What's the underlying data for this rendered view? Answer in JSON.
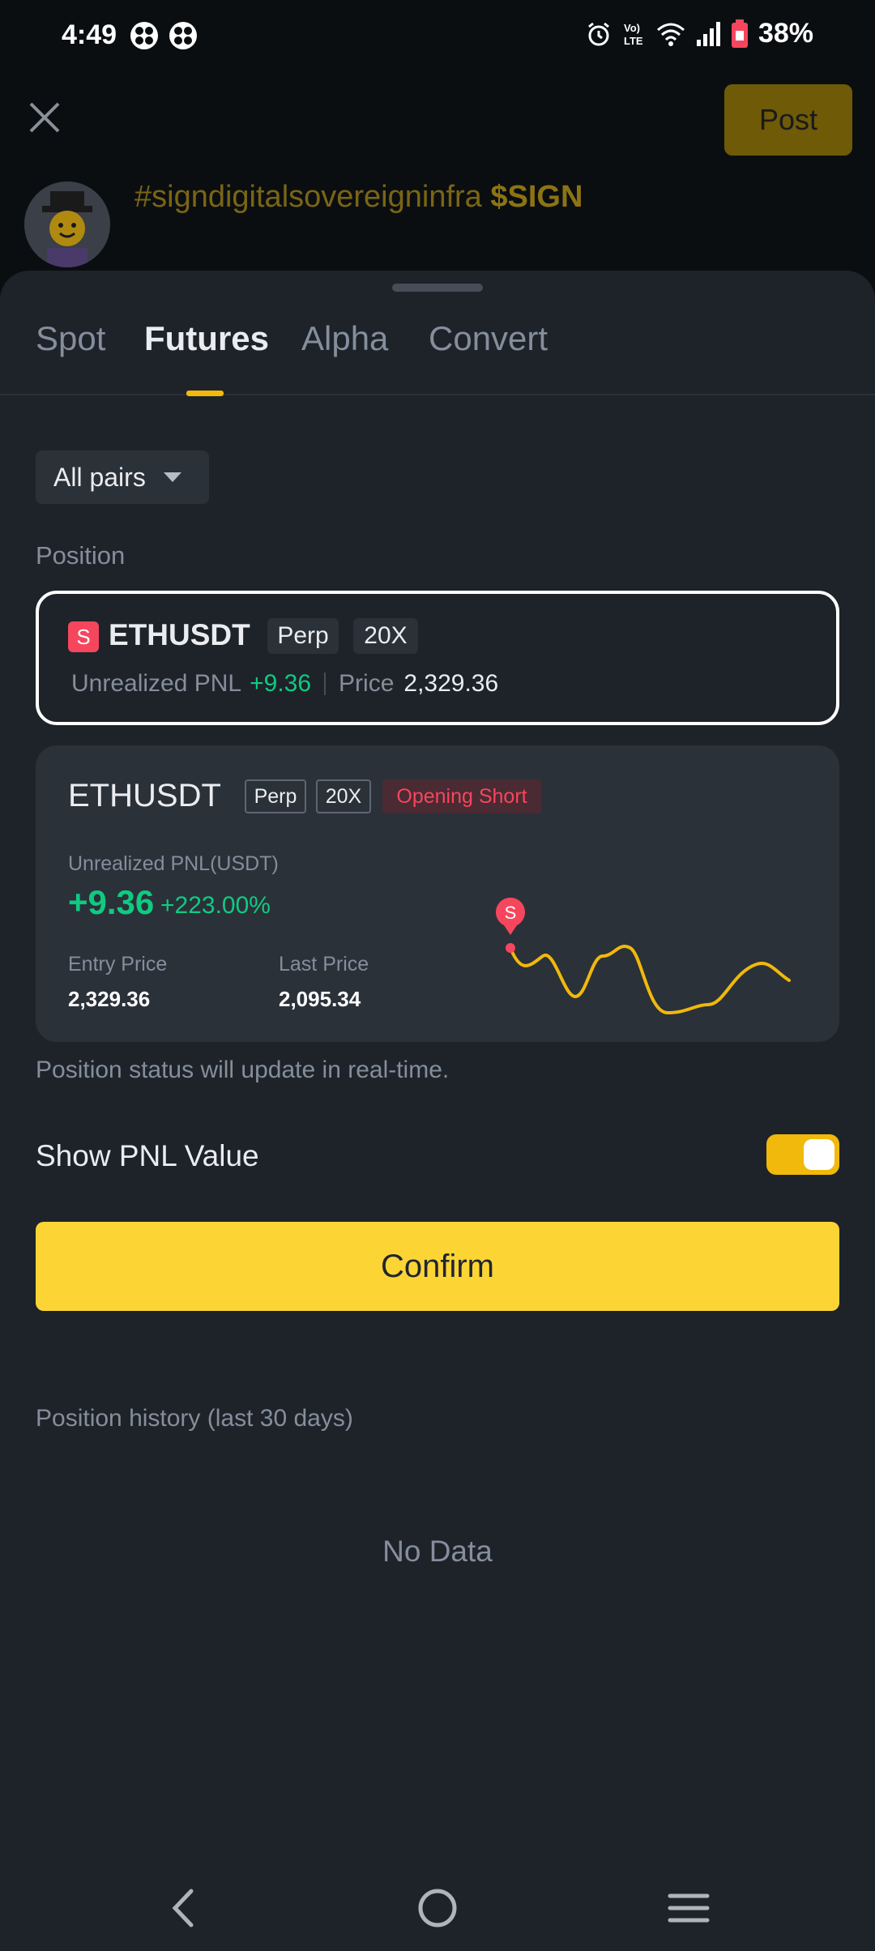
{
  "status_bar": {
    "time": "4:49",
    "battery_pct": "38%",
    "icons": [
      "app-icon",
      "app-icon",
      "alarm-icon",
      "volte-icon",
      "wifi-icon",
      "signal-icon",
      "battery-icon"
    ]
  },
  "compose": {
    "post_label": "Post",
    "text_hashtag": "#signdigitalsovereigninfra",
    "text_ticker": "$SIGN"
  },
  "tabs": [
    {
      "label": "Spot",
      "active": false
    },
    {
      "label": "Futures",
      "active": true
    },
    {
      "label": "Alpha",
      "active": false
    },
    {
      "label": "Convert",
      "active": false
    }
  ],
  "filter": {
    "label": "All pairs"
  },
  "position_section": {
    "label": "Position"
  },
  "position_card": {
    "badge": "S",
    "symbol": "ETHUSDT",
    "tag_type": "Perp",
    "tag_leverage": "20X",
    "pnl_label": "Unrealized PNL",
    "pnl_value": "+9.36",
    "price_label": "Price",
    "price_value": "2,329.36"
  },
  "share_card": {
    "symbol": "ETHUSDT",
    "tag_type": "Perp",
    "tag_leverage": "20X",
    "tag_side": "Opening Short",
    "pnl_label": "Unrealized PNL(USDT)",
    "pnl_value": "+9.36",
    "pnl_pct": "+223.00%",
    "entry_label": "Entry Price",
    "entry_value": "2,329.36",
    "last_label": "Last Price",
    "last_value": "2,095.34",
    "marker": "S"
  },
  "note": "Position status will update in real-time.",
  "show_pnl": {
    "label": "Show PNL Value",
    "enabled": true
  },
  "confirm_label": "Confirm",
  "history": {
    "label": "Position history (last 30 days)",
    "empty_text": "No Data"
  },
  "colors": {
    "accent": "#fcd535",
    "up": "#0ecb81",
    "down": "#f6465d",
    "sheet_bg": "#1e2329"
  }
}
